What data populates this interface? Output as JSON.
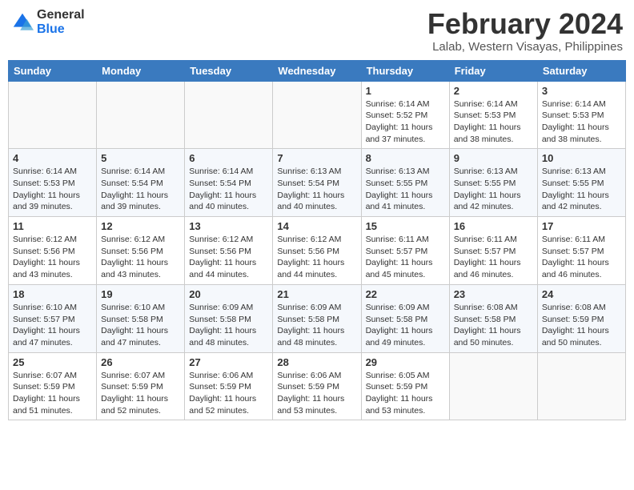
{
  "header": {
    "logo_general": "General",
    "logo_blue": "Blue",
    "month_title": "February 2024",
    "location": "Lalab, Western Visayas, Philippines"
  },
  "weekdays": [
    "Sunday",
    "Monday",
    "Tuesday",
    "Wednesday",
    "Thursday",
    "Friday",
    "Saturday"
  ],
  "weeks": [
    [
      {
        "day": "",
        "info": ""
      },
      {
        "day": "",
        "info": ""
      },
      {
        "day": "",
        "info": ""
      },
      {
        "day": "",
        "info": ""
      },
      {
        "day": "1",
        "info": "Sunrise: 6:14 AM\nSunset: 5:52 PM\nDaylight: 11 hours\nand 37 minutes."
      },
      {
        "day": "2",
        "info": "Sunrise: 6:14 AM\nSunset: 5:53 PM\nDaylight: 11 hours\nand 38 minutes."
      },
      {
        "day": "3",
        "info": "Sunrise: 6:14 AM\nSunset: 5:53 PM\nDaylight: 11 hours\nand 38 minutes."
      }
    ],
    [
      {
        "day": "4",
        "info": "Sunrise: 6:14 AM\nSunset: 5:53 PM\nDaylight: 11 hours\nand 39 minutes."
      },
      {
        "day": "5",
        "info": "Sunrise: 6:14 AM\nSunset: 5:54 PM\nDaylight: 11 hours\nand 39 minutes."
      },
      {
        "day": "6",
        "info": "Sunrise: 6:14 AM\nSunset: 5:54 PM\nDaylight: 11 hours\nand 40 minutes."
      },
      {
        "day": "7",
        "info": "Sunrise: 6:13 AM\nSunset: 5:54 PM\nDaylight: 11 hours\nand 40 minutes."
      },
      {
        "day": "8",
        "info": "Sunrise: 6:13 AM\nSunset: 5:55 PM\nDaylight: 11 hours\nand 41 minutes."
      },
      {
        "day": "9",
        "info": "Sunrise: 6:13 AM\nSunset: 5:55 PM\nDaylight: 11 hours\nand 42 minutes."
      },
      {
        "day": "10",
        "info": "Sunrise: 6:13 AM\nSunset: 5:55 PM\nDaylight: 11 hours\nand 42 minutes."
      }
    ],
    [
      {
        "day": "11",
        "info": "Sunrise: 6:12 AM\nSunset: 5:56 PM\nDaylight: 11 hours\nand 43 minutes."
      },
      {
        "day": "12",
        "info": "Sunrise: 6:12 AM\nSunset: 5:56 PM\nDaylight: 11 hours\nand 43 minutes."
      },
      {
        "day": "13",
        "info": "Sunrise: 6:12 AM\nSunset: 5:56 PM\nDaylight: 11 hours\nand 44 minutes."
      },
      {
        "day": "14",
        "info": "Sunrise: 6:12 AM\nSunset: 5:56 PM\nDaylight: 11 hours\nand 44 minutes."
      },
      {
        "day": "15",
        "info": "Sunrise: 6:11 AM\nSunset: 5:57 PM\nDaylight: 11 hours\nand 45 minutes."
      },
      {
        "day": "16",
        "info": "Sunrise: 6:11 AM\nSunset: 5:57 PM\nDaylight: 11 hours\nand 46 minutes."
      },
      {
        "day": "17",
        "info": "Sunrise: 6:11 AM\nSunset: 5:57 PM\nDaylight: 11 hours\nand 46 minutes."
      }
    ],
    [
      {
        "day": "18",
        "info": "Sunrise: 6:10 AM\nSunset: 5:57 PM\nDaylight: 11 hours\nand 47 minutes."
      },
      {
        "day": "19",
        "info": "Sunrise: 6:10 AM\nSunset: 5:58 PM\nDaylight: 11 hours\nand 47 minutes."
      },
      {
        "day": "20",
        "info": "Sunrise: 6:09 AM\nSunset: 5:58 PM\nDaylight: 11 hours\nand 48 minutes."
      },
      {
        "day": "21",
        "info": "Sunrise: 6:09 AM\nSunset: 5:58 PM\nDaylight: 11 hours\nand 48 minutes."
      },
      {
        "day": "22",
        "info": "Sunrise: 6:09 AM\nSunset: 5:58 PM\nDaylight: 11 hours\nand 49 minutes."
      },
      {
        "day": "23",
        "info": "Sunrise: 6:08 AM\nSunset: 5:58 PM\nDaylight: 11 hours\nand 50 minutes."
      },
      {
        "day": "24",
        "info": "Sunrise: 6:08 AM\nSunset: 5:59 PM\nDaylight: 11 hours\nand 50 minutes."
      }
    ],
    [
      {
        "day": "25",
        "info": "Sunrise: 6:07 AM\nSunset: 5:59 PM\nDaylight: 11 hours\nand 51 minutes."
      },
      {
        "day": "26",
        "info": "Sunrise: 6:07 AM\nSunset: 5:59 PM\nDaylight: 11 hours\nand 52 minutes."
      },
      {
        "day": "27",
        "info": "Sunrise: 6:06 AM\nSunset: 5:59 PM\nDaylight: 11 hours\nand 52 minutes."
      },
      {
        "day": "28",
        "info": "Sunrise: 6:06 AM\nSunset: 5:59 PM\nDaylight: 11 hours\nand 53 minutes."
      },
      {
        "day": "29",
        "info": "Sunrise: 6:05 AM\nSunset: 5:59 PM\nDaylight: 11 hours\nand 53 minutes."
      },
      {
        "day": "",
        "info": ""
      },
      {
        "day": "",
        "info": ""
      }
    ]
  ]
}
